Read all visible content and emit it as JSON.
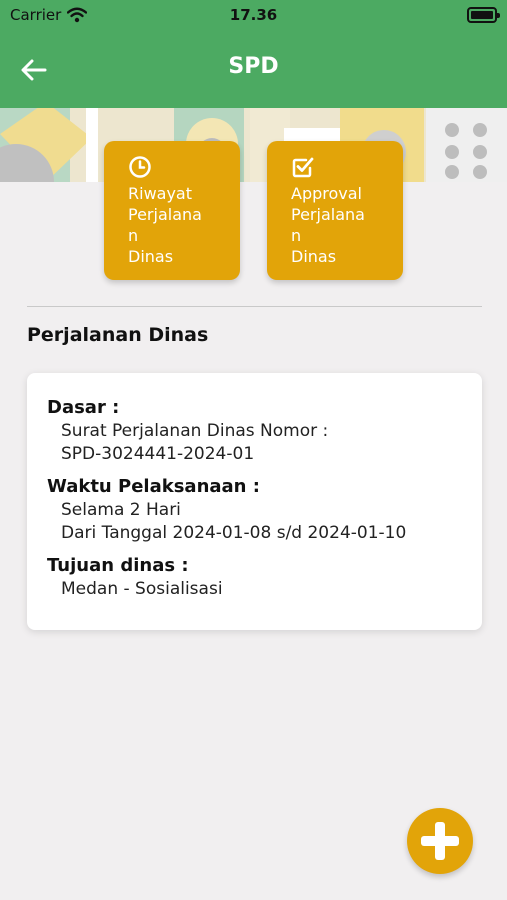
{
  "status_bar": {
    "carrier": "Carrier",
    "time": "17.36"
  },
  "header": {
    "title": "SPD"
  },
  "menu": [
    {
      "label": "Riwayat\nPerjalana\nn\nDinas",
      "icon": "clock-icon"
    },
    {
      "label": "Approval\nPerjalana\nn\nDinas",
      "icon": "checkbox-icon"
    }
  ],
  "section": {
    "title": "Perjalanan Dinas"
  },
  "trip": {
    "dasar_label": "Dasar :",
    "dasar_line1": "Surat Perjalanan Dinas Nomor :",
    "dasar_line2": "SPD-3024441-2024-01",
    "waktu_label": "Waktu Pelaksanaan :",
    "waktu_line1": "Selama 2 Hari",
    "waktu_line2": "Dari Tanggal 2024-01-08 s/d 2024-01-10",
    "tujuan_label": "Tujuan dinas :",
    "tujuan_line1": "Medan - Sosialisasi"
  },
  "colors": {
    "primary": "#4caa62",
    "accent": "#e2a409",
    "background": "#f1eff0"
  }
}
